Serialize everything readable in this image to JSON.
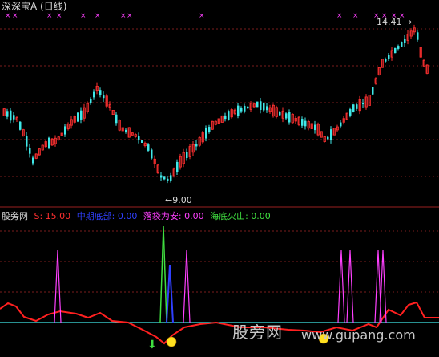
{
  "header": {
    "title": "深深宝A (日线)",
    "high_marker": "14.41",
    "low_marker": "9.00"
  },
  "indicator_bar": {
    "name": "股旁网",
    "items": [
      {
        "label": "S: 15.00",
        "color": "#ff3030"
      },
      {
        "label": "中期底部: 0.00",
        "color": "#3040ff"
      },
      {
        "label": "落袋为安: 0.00",
        "color": "#ff40ff"
      },
      {
        "label": "海底火山: 0.00",
        "color": "#40e040"
      }
    ]
  },
  "watermark": {
    "site": "股旁网",
    "url": "www.gupang.com"
  },
  "colors": {
    "up": "#ff3030",
    "down": "#40e8e8",
    "pink": "#ff40ff",
    "blue": "#3040ff",
    "green": "#40e040",
    "grid": "#7a1c1c"
  },
  "icons": [
    "smiley-icon",
    "down-arrow-icon",
    "x-marker-icon"
  ]
}
